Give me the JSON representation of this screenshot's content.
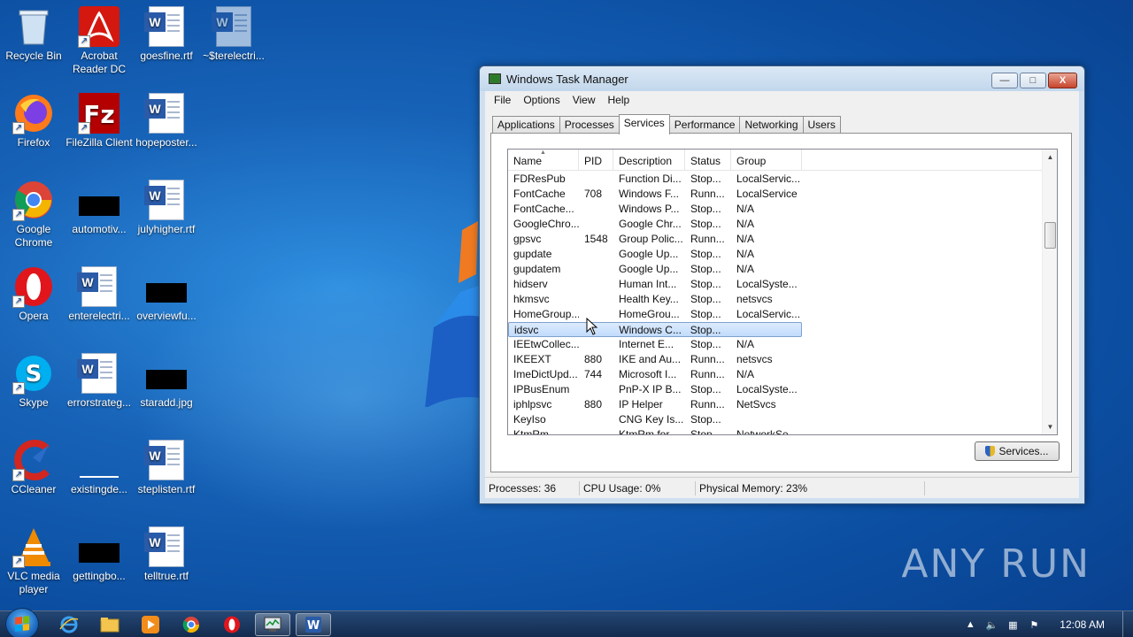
{
  "desktop": {
    "icons": [
      {
        "label": "Recycle Bin"
      },
      {
        "label": "Acrobat Reader DC"
      },
      {
        "label": "goesfine.rtf"
      },
      {
        "label": "~$terelectri..."
      },
      {
        "label": "Firefox"
      },
      {
        "label": "FileZilla Client"
      },
      {
        "label": "hopeposter..."
      },
      {
        "label": "Google Chrome"
      },
      {
        "label": "automotiv..."
      },
      {
        "label": "julyhigher.rtf"
      },
      {
        "label": "Opera"
      },
      {
        "label": "enterelectri..."
      },
      {
        "label": "overviewfu..."
      },
      {
        "label": "Skype"
      },
      {
        "label": "errorstrateg..."
      },
      {
        "label": "staradd.jpg"
      },
      {
        "label": "CCleaner"
      },
      {
        "label": "existingde..."
      },
      {
        "label": "steplisten.rtf"
      },
      {
        "label": "VLC media player"
      },
      {
        "label": "gettingbo..."
      },
      {
        "label": "telltrue.rtf"
      }
    ],
    "watermark": "ANY RUN"
  },
  "window": {
    "title": "Windows Task Manager",
    "controls": {
      "minimize": "—",
      "maximize": "□",
      "close": "X"
    },
    "menu": [
      "File",
      "Options",
      "View",
      "Help"
    ],
    "tabs": [
      "Applications",
      "Processes",
      "Services",
      "Performance",
      "Networking",
      "Users"
    ],
    "active_tab": "Services",
    "columns": [
      "Name",
      "PID",
      "Description",
      "Status",
      "Group"
    ],
    "rows": [
      {
        "name": "FDResPub",
        "pid": "",
        "desc": "Function Di...",
        "status": "Stop...",
        "group": "LocalServic..."
      },
      {
        "name": "FontCache",
        "pid": "708",
        "desc": "Windows F...",
        "status": "Runn...",
        "group": "LocalService"
      },
      {
        "name": "FontCache...",
        "pid": "",
        "desc": "Windows P...",
        "status": "Stop...",
        "group": "N/A"
      },
      {
        "name": "GoogleChro...",
        "pid": "",
        "desc": "Google Chr...",
        "status": "Stop...",
        "group": "N/A"
      },
      {
        "name": "gpsvc",
        "pid": "1548",
        "desc": "Group Polic...",
        "status": "Runn...",
        "group": "N/A"
      },
      {
        "name": "gupdate",
        "pid": "",
        "desc": "Google Up...",
        "status": "Stop...",
        "group": "N/A"
      },
      {
        "name": "gupdatem",
        "pid": "",
        "desc": "Google Up...",
        "status": "Stop...",
        "group": "N/A"
      },
      {
        "name": "hidserv",
        "pid": "",
        "desc": "Human Int...",
        "status": "Stop...",
        "group": "LocalSyste..."
      },
      {
        "name": "hkmsvc",
        "pid": "",
        "desc": "Health Key...",
        "status": "Stop...",
        "group": "netsvcs"
      },
      {
        "name": "HomeGroup...",
        "pid": "",
        "desc": "HomeGrou...",
        "status": "Stop...",
        "group": "LocalServic..."
      },
      {
        "name": "idsvc",
        "pid": "",
        "desc": "Windows C...",
        "status": "Stop...",
        "group": ""
      },
      {
        "name": "IEEtwCollec...",
        "pid": "",
        "desc": "Internet E...",
        "status": "Stop...",
        "group": "N/A"
      },
      {
        "name": "IKEEXT",
        "pid": "880",
        "desc": "IKE and Au...",
        "status": "Runn...",
        "group": "netsvcs"
      },
      {
        "name": "ImeDictUpd...",
        "pid": "744",
        "desc": "Microsoft I...",
        "status": "Runn...",
        "group": "N/A"
      },
      {
        "name": "IPBusEnum",
        "pid": "",
        "desc": "PnP-X IP B...",
        "status": "Stop...",
        "group": "LocalSyste..."
      },
      {
        "name": "iphlpsvc",
        "pid": "880",
        "desc": "IP Helper",
        "status": "Runn...",
        "group": "NetSvcs"
      },
      {
        "name": "KeyIso",
        "pid": "",
        "desc": "CNG Key Is...",
        "status": "Stop...",
        "group": ""
      },
      {
        "name": "KtmRm",
        "pid": "",
        "desc": "KtmRm for...",
        "status": "Stop...",
        "group": "NetworkSe..."
      }
    ],
    "selected_row": "idsvc",
    "services_button": "Services...",
    "status": {
      "processes": "Processes: 36",
      "cpu": "CPU Usage: 0%",
      "memory": "Physical Memory: 23%"
    }
  },
  "taskbar": {
    "clock": "12:08 AM",
    "pinned": [
      "internet-explorer",
      "file-explorer",
      "media-player",
      "chrome",
      "opera",
      "task-manager",
      "word"
    ]
  }
}
